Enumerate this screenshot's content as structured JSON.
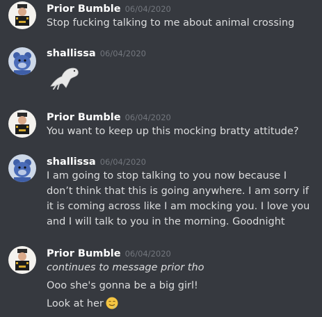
{
  "messages": [
    {
      "author": "Prior Bumble",
      "timestamp": "06/04/2020",
      "lines": [
        "Stop fucking talking to me about animal crossing"
      ]
    },
    {
      "author": "shallissa",
      "timestamp": "06/04/2020",
      "attachment": "seal-image"
    },
    {
      "author": "Prior Bumble",
      "timestamp": "06/04/2020",
      "lines": [
        "You want to keep up this mocking bratty attitude?"
      ]
    },
    {
      "author": "shallissa",
      "timestamp": "06/04/2020",
      "lines": [
        "I am going to stop talking to you now because I don’t think that this is going anywhere. I am sorry if it is coming across like I am mocking you. I love you and I will talk to you in the morning. Goodnight"
      ]
    },
    {
      "author": "Prior Bumble",
      "timestamp": "06/04/2020",
      "lines": [
        "continues to message prior tho",
        "Ooo she's gonna be a big girl!",
        "Look at her"
      ],
      "trailing_emoji": "drooling-face-emoji"
    }
  ],
  "colors": {
    "background": "#36393f",
    "author": "#ffffff",
    "timestamp": "#72767d",
    "text": "#dcddde"
  }
}
